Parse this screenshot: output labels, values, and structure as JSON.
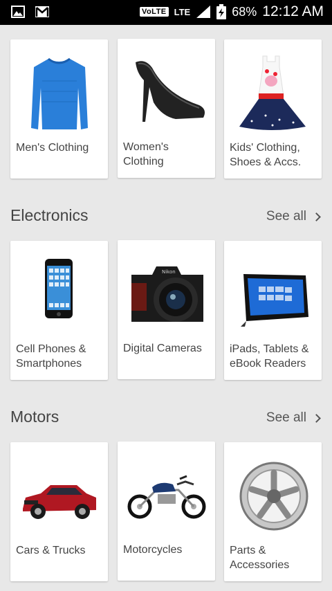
{
  "status_bar": {
    "volte": "VoLTE",
    "network": "LTE",
    "battery": "68%",
    "time": "12:12 AM",
    "icons": [
      "gallery-icon",
      "gmail-icon",
      "signal-icon",
      "battery-charging-icon"
    ]
  },
  "fashion": {
    "items": [
      {
        "label": "Men's Clothing",
        "icon": "shirt-icon"
      },
      {
        "label": "Women's Clothing",
        "icon": "heel-icon"
      },
      {
        "label": "Kids' Clothing, Shoes & Accs.",
        "icon": "dress-icon"
      }
    ]
  },
  "electronics": {
    "title": "Electronics",
    "see_all": "See all",
    "items": [
      {
        "label": "Cell Phones & Smartphones",
        "icon": "phone-icon"
      },
      {
        "label": "Digital Cameras",
        "icon": "camera-icon"
      },
      {
        "label": "iPads, Tablets & eBook Readers",
        "icon": "tablet-icon"
      }
    ]
  },
  "motors": {
    "title": "Motors",
    "see_all": "See all",
    "items": [
      {
        "label": "Cars & Trucks",
        "icon": "car-icon"
      },
      {
        "label": "Motorcycles",
        "icon": "motorcycle-icon"
      },
      {
        "label": "Parts & Accessories",
        "icon": "wheel-icon"
      }
    ]
  },
  "colors": {
    "background": "#e8e8e8",
    "card": "#ffffff",
    "text": "#444444"
  }
}
